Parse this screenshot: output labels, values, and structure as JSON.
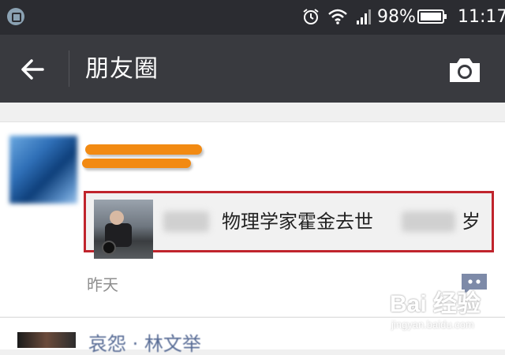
{
  "status_bar": {
    "battery_percent": "98%",
    "time": "11:17",
    "icons": [
      "app-notification-icon",
      "alarm-icon",
      "wifi-icon",
      "signal-icon",
      "battery-icon"
    ]
  },
  "title_bar": {
    "title": "朋友圈",
    "back_icon": "back-arrow-icon",
    "camera_icon": "camera-icon"
  },
  "post": {
    "link_title": "物理学家霍金去世",
    "link_suffix": "岁",
    "time": "昨天",
    "comment_icon": "comment-icon"
  },
  "next_post": {
    "name": "哀怨 · 林文举"
  },
  "watermark": {
    "text": "Bai 经验",
    "sub": "jingyan.baidu.com"
  },
  "colors": {
    "status_bar_bg": "#2b2c31",
    "title_bar_bg": "#393a3f",
    "highlight_border": "#c0242c",
    "name_redaction": "#f28a12",
    "link_name_color": "#576b95"
  }
}
